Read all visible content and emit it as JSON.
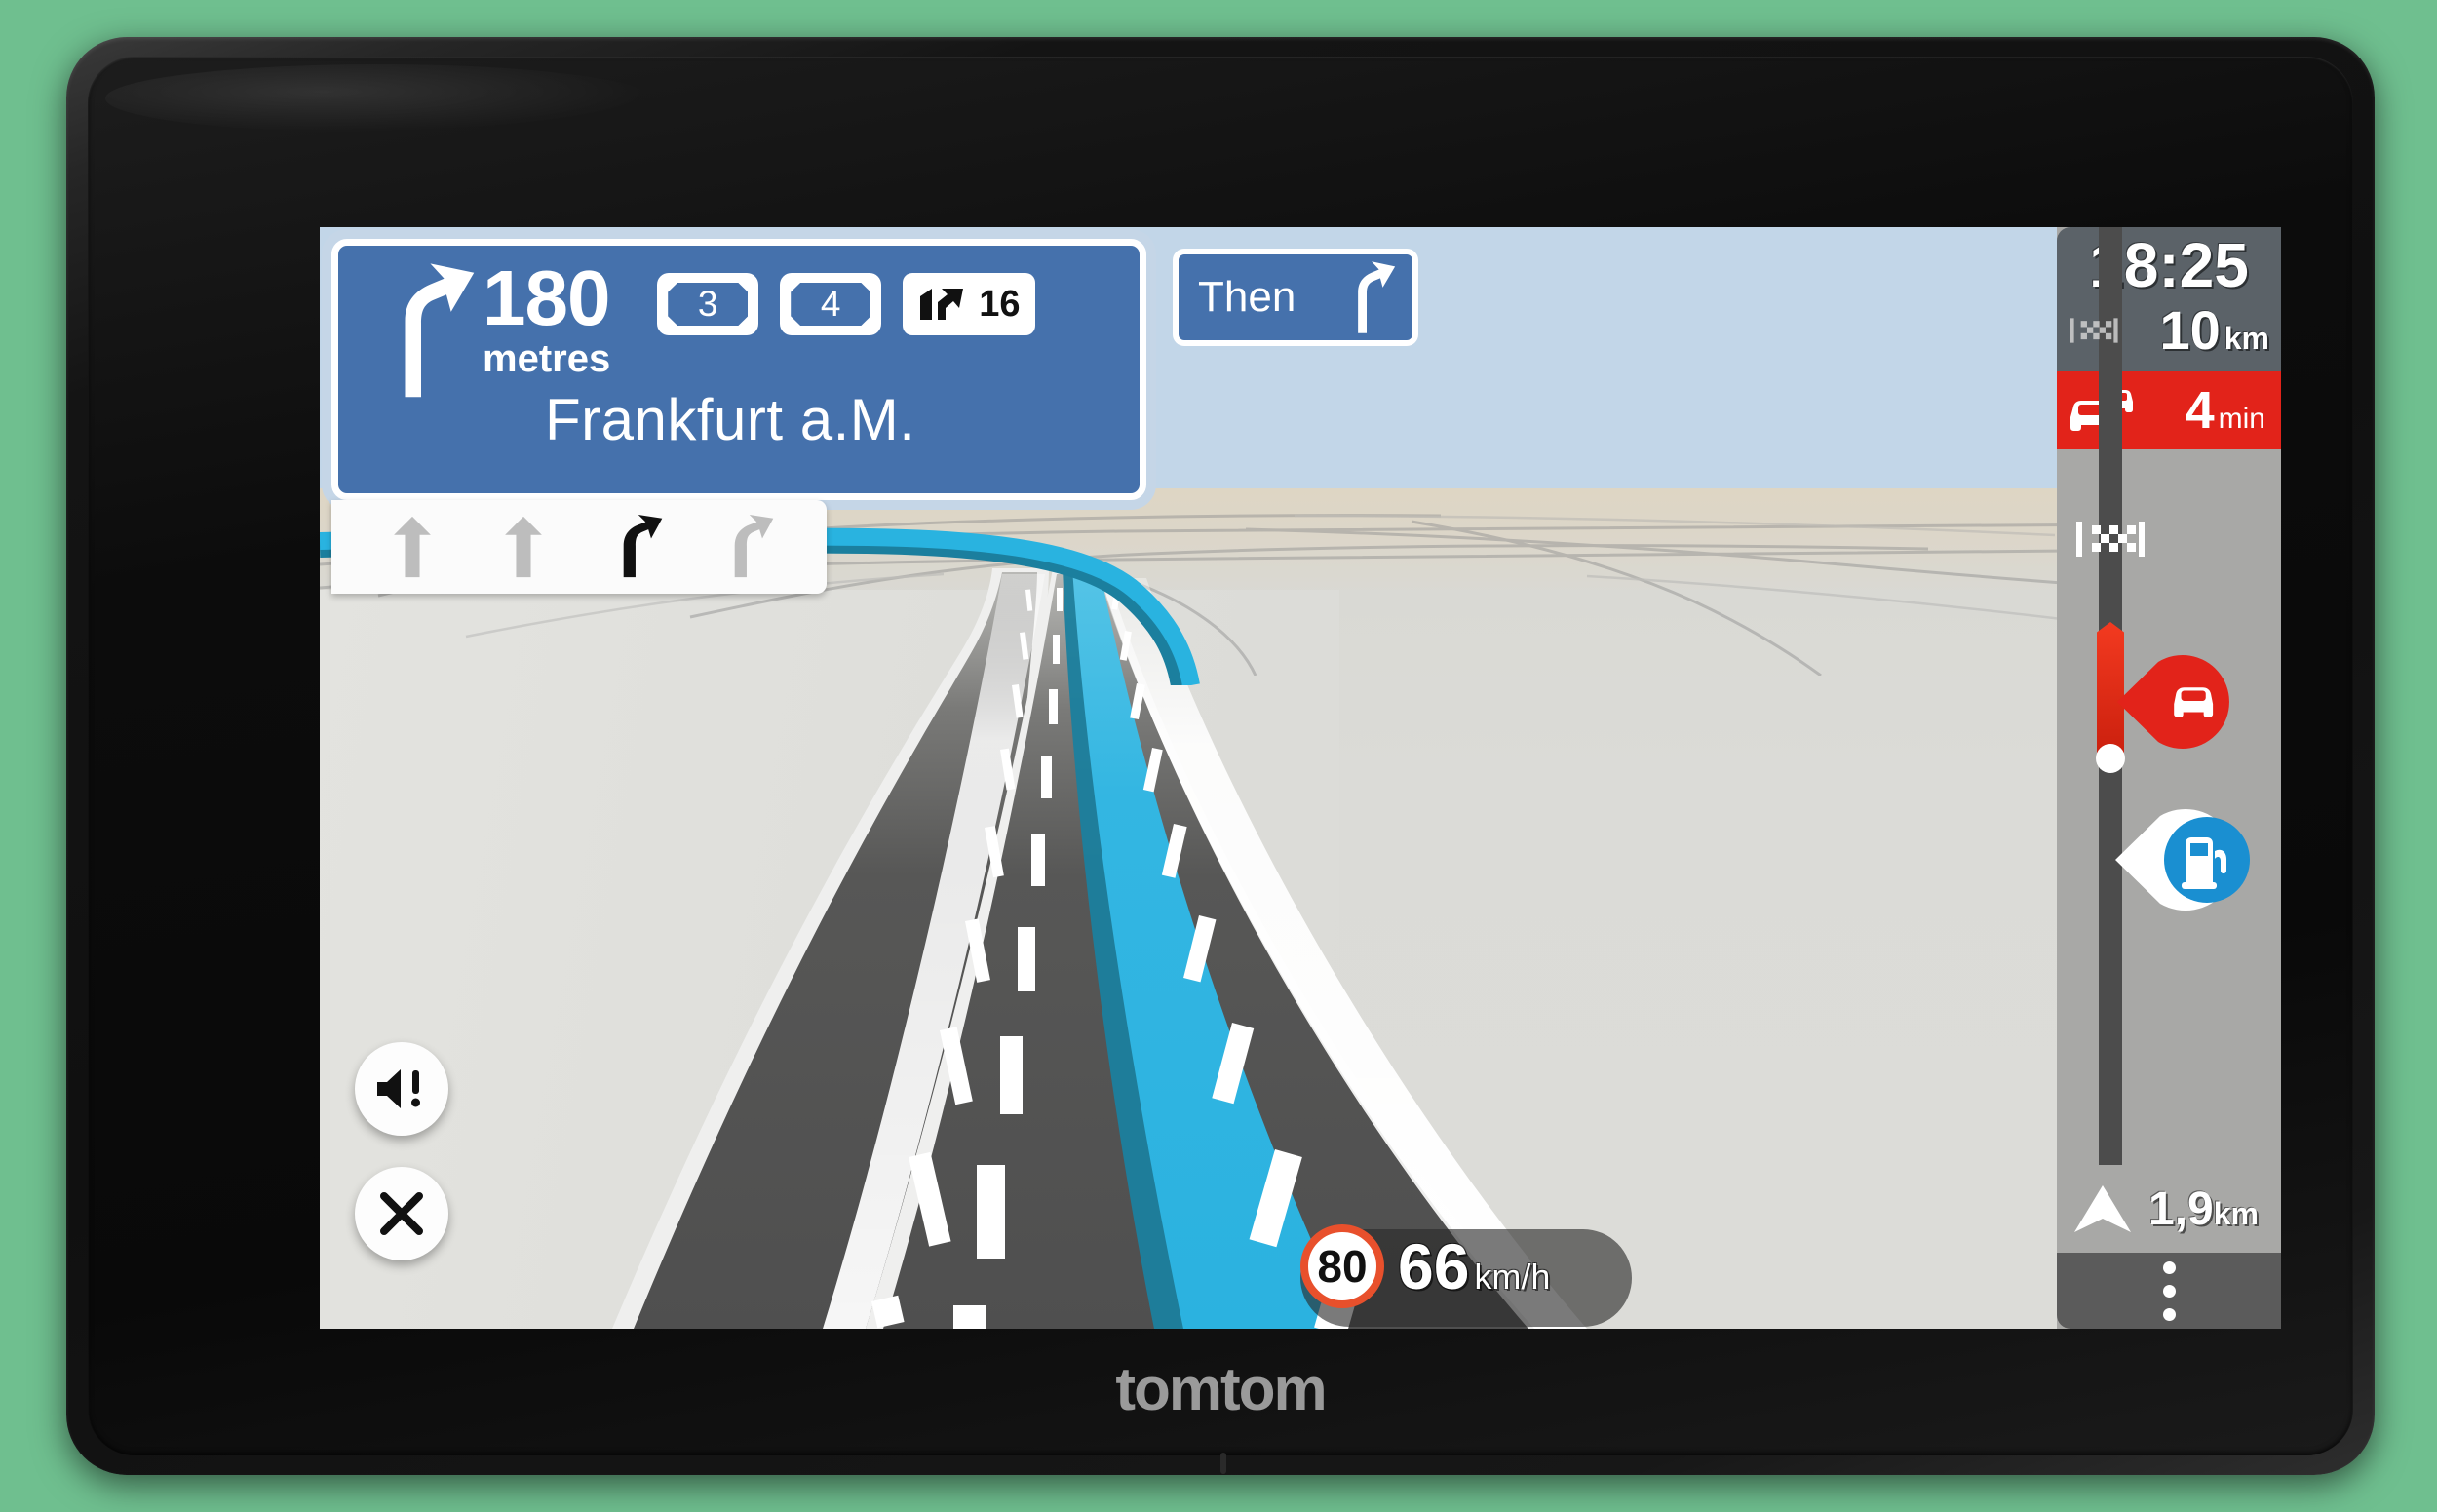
{
  "device": {
    "brand": "tomtom",
    "screen_label": "navigation-display"
  },
  "instruction": {
    "distance_value": "180",
    "distance_unit": "metres",
    "maneuver_icon": "bear-right-arrow-icon",
    "destination": "Frankfurt a.M.",
    "exit_shields": [
      "3",
      "4"
    ],
    "road_badge": {
      "icon": "motorway-split-icon",
      "label": "16"
    },
    "panel_color": "#4571ac"
  },
  "then_panel": {
    "label": "Then",
    "maneuver_icon": "bear-right-arrow-icon"
  },
  "lanes": [
    {
      "direction": "straight",
      "active": false
    },
    {
      "direction": "straight",
      "active": false
    },
    {
      "direction": "bear-right",
      "active": true
    },
    {
      "direction": "bear-right",
      "active": false
    }
  ],
  "buttons": {
    "mute": {
      "icon": "speaker-alert-icon",
      "label": ""
    },
    "close": {
      "icon": "close-x-icon",
      "label": ""
    }
  },
  "speed": {
    "limit": "80",
    "current": "66",
    "unit": "km/h",
    "limit_ring_color": "#e8502c"
  },
  "route_bar": {
    "arrival_time": "18:25",
    "destination_icon": "checkered-flag-icon",
    "remaining_distance": "10",
    "remaining_distance_unit": "km",
    "traffic": {
      "icon": "traffic-cars-icon",
      "delay_value": "4",
      "delay_unit": "min",
      "color": "#e2231a"
    },
    "events": [
      {
        "icon": "checkered-flag-icon",
        "type": "destination",
        "position_pct": 11
      },
      {
        "icon": "car-incident-icon",
        "type": "traffic-jam",
        "color": "#e2231a",
        "position_pct": 41
      },
      {
        "icon": "fuel-station-icon",
        "type": "petrol-station",
        "color": "#1a8fd1",
        "position_pct": 57
      }
    ],
    "current_position_icon": "navigation-chevron-icon",
    "distance_to_next_event": "1,9",
    "distance_to_next_event_unit": "km",
    "menu_icon": "more-vertical-icon"
  },
  "map": {
    "sky_color": "#c2d6e8",
    "ground_color": "#d9d9d4",
    "road_color": "#525252",
    "route_color": "#29b3e0",
    "route_shadow_color": "#1b7f9e"
  }
}
